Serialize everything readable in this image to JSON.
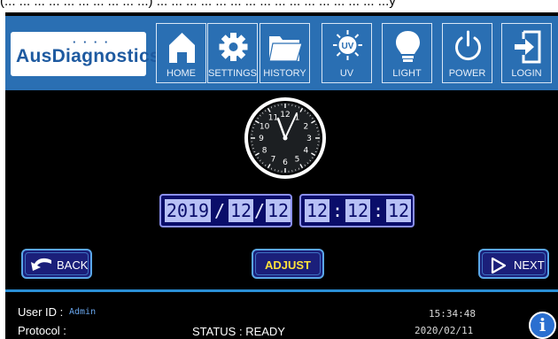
{
  "caption_fragment": "(... ... ... ... ... ... ... ... ... ...) ... ... ... ... ... ... ... ... ... ... ... ... ... ... ... ...y",
  "brand": {
    "name": "AusDiagnostics"
  },
  "toolbar": {
    "items": [
      {
        "label": "HOME",
        "icon": "home-icon"
      },
      {
        "label": "SETTINGS",
        "icon": "gear-icon"
      },
      {
        "label": "HISTORY",
        "icon": "folder-icon"
      },
      {
        "label": "UV",
        "icon": "uv-icon",
        "icon_text": "UV"
      },
      {
        "label": "LIGHT",
        "icon": "lightbulb-icon"
      },
      {
        "label": "POWER",
        "icon": "power-icon"
      },
      {
        "label": "LOGIN",
        "icon": "login-icon"
      }
    ]
  },
  "clock": {
    "numbers": [
      "12",
      "1",
      "2",
      "3",
      "4",
      "5",
      "6",
      "7",
      "8",
      "9",
      "10",
      "11"
    ]
  },
  "datetime": {
    "year": "2019",
    "month": "12",
    "day": "12",
    "hour": "12",
    "minute": "12",
    "second": "12",
    "date_sep": "/",
    "time_sep": ":"
  },
  "actions": {
    "back_label": "BACK",
    "adjust_label": "ADJUST",
    "next_label": "NEXT"
  },
  "status": {
    "user_id_label": "User ID :",
    "user_id_value": "Admin",
    "protocol_label": "Protocol :",
    "status_text": "STATUS : READY",
    "time": "15:34:48",
    "date": "2020/02/11",
    "info_glyph": "i"
  },
  "colors": {
    "toolbar_bg": "#2a6fb3",
    "screen_bg": "#000000",
    "field_bg": "#b7c0f5",
    "accent": "#2a8fd6",
    "adjust_text": "#ffe23a"
  }
}
